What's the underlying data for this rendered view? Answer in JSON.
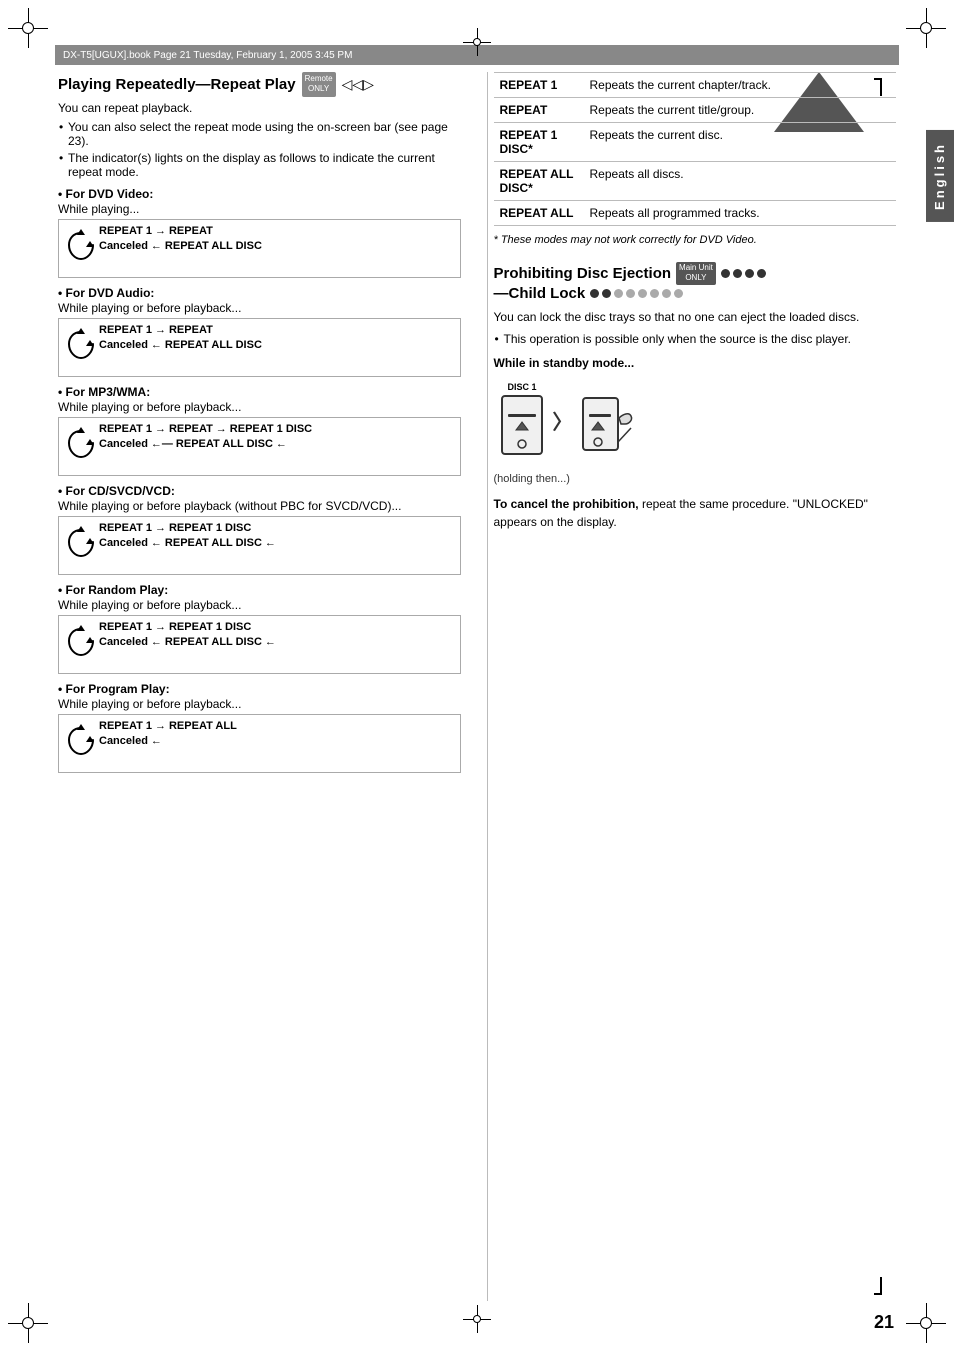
{
  "page": {
    "number": "21",
    "header_text": "DX-T5[UGUX].book  Page 21  Tuesday, February 1, 2005  3:45 PM"
  },
  "left_section": {
    "title": "Playing Repeatedly—Repeat Play",
    "remote_badge": "Remote ONLY",
    "intro_text": "You can repeat playback.",
    "bullets": [
      "You can also select the repeat mode using the on-screen bar (see page 23).",
      "The indicator(s) lights on the display as follows to indicate the current repeat mode."
    ],
    "dvd_video": {
      "label": "• For DVD Video:",
      "sub": "While playing...",
      "flow": "REPEAT → REPEAT 1 → REPEAT / Canceled ← REPEAT ALL DISC"
    },
    "dvd_audio": {
      "label": "• For DVD Audio:",
      "sub": "While playing or before playback...",
      "flow": "REPEAT → REPEAT 1 → REPEAT / Canceled ← REPEAT ALL DISC"
    },
    "mp3_wma": {
      "label": "• For MP3/WMA:",
      "sub": "While playing or before playback...",
      "flow": "REPEAT → REPEAT 1 → REPEAT → REPEAT 1 DISC / Canceled ← REPEAT ALL DISC"
    },
    "cd_svcd_vcd": {
      "label": "• For CD/SVCD/VCD:",
      "sub": "While playing or before playback (without PBC for SVCD/VCD)...",
      "flow": "REPEAT → REPEAT 1 → REPEAT 1 DISC / Canceled ← REPEAT ALL DISC"
    },
    "random_play": {
      "label": "• For Random Play:",
      "sub": "While playing or before playback...",
      "flow": "REPEAT → REPEAT 1 → REPEAT 1 DISC / Canceled ← REPEAT ALL DISC"
    },
    "program_play": {
      "label": "• For Program Play:",
      "sub": "While playing or before playback...",
      "flow": "REPEAT → REPEAT 1 → REPEAT ALL / Canceled ←"
    }
  },
  "right_section": {
    "repeat_table": [
      {
        "mode": "REPEAT 1",
        "desc": "Repeats the current chapter/track."
      },
      {
        "mode": "REPEAT",
        "desc": "Repeats the current title/group."
      },
      {
        "mode": "REPEAT 1 DISC*",
        "desc": "Repeats the current disc."
      },
      {
        "mode": "REPEAT ALL DISC*",
        "desc": "Repeats all discs."
      },
      {
        "mode": "REPEAT ALL",
        "desc": "Repeats all programmed tracks."
      }
    ],
    "footnote": "* These modes may not work correctly for DVD Video.",
    "prohibiting_title": "Prohibiting Disc Ejection",
    "child_lock_title": "—Child Lock",
    "main_unit_badge": "Main Unit ONLY",
    "intro_text": "You can lock the disc trays so that no one can eject the loaded discs.",
    "bullet": "This operation is possible only when the source is the disc player.",
    "standby_label": "While in standby mode...",
    "disc_label": "DISC 1",
    "holding_text": "(holding then...)",
    "cancel_bold": "To cancel the prohibition,",
    "cancel_text": " repeat the same procedure. \"UNLOCKED\" appears on the display."
  }
}
